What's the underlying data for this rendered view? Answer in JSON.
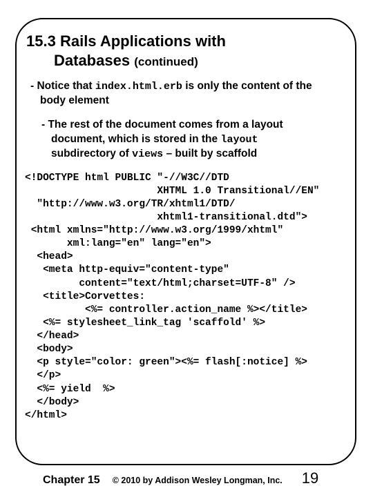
{
  "title": {
    "number": "15.3",
    "text": "Rails Applications with",
    "line2": "Databases",
    "suffix": "(continued)"
  },
  "bullet1": {
    "lead": "- Notice that ",
    "code": "index.html.erb",
    "rest": " is only the content of the",
    "line2": "body element"
  },
  "bullet2": {
    "line1": "- The rest of the document comes from a layout",
    "line2a": "document, which is stored in the ",
    "code": "layout",
    "line3a": "subdirectory of ",
    "code2": "views",
    "line3b": " – built by scaffold"
  },
  "code": "<!DOCTYPE html PUBLIC \"-//W3C//DTD\n                      XHTML 1.0 Transitional//EN\"\n  \"http://www.w3.org/TR/xhtml1/DTD/\n                      xhtml1-transitional.dtd\">\n <html xmlns=\"http://www.w3.org/1999/xhtml\"\n       xml:lang=\"en\" lang=\"en\">\n  <head>\n   <meta http-equiv=\"content-type\"\n         content=\"text/html;charset=UTF-8\" />\n   <title>Corvettes:\n          <%= controller.action_name %></title>\n   <%= stylesheet_link_tag 'scaffold' %>\n  </head>\n  <body>\n  <p style=\"color: green\"><%= flash[:notice] %>\n  </p>\n  <%= yield  %>\n  </body>\n</html>",
  "footer": {
    "chapter": "Chapter 15",
    "copyright": "© 2010 by Addison Wesley Longman, Inc.",
    "page": "19"
  }
}
